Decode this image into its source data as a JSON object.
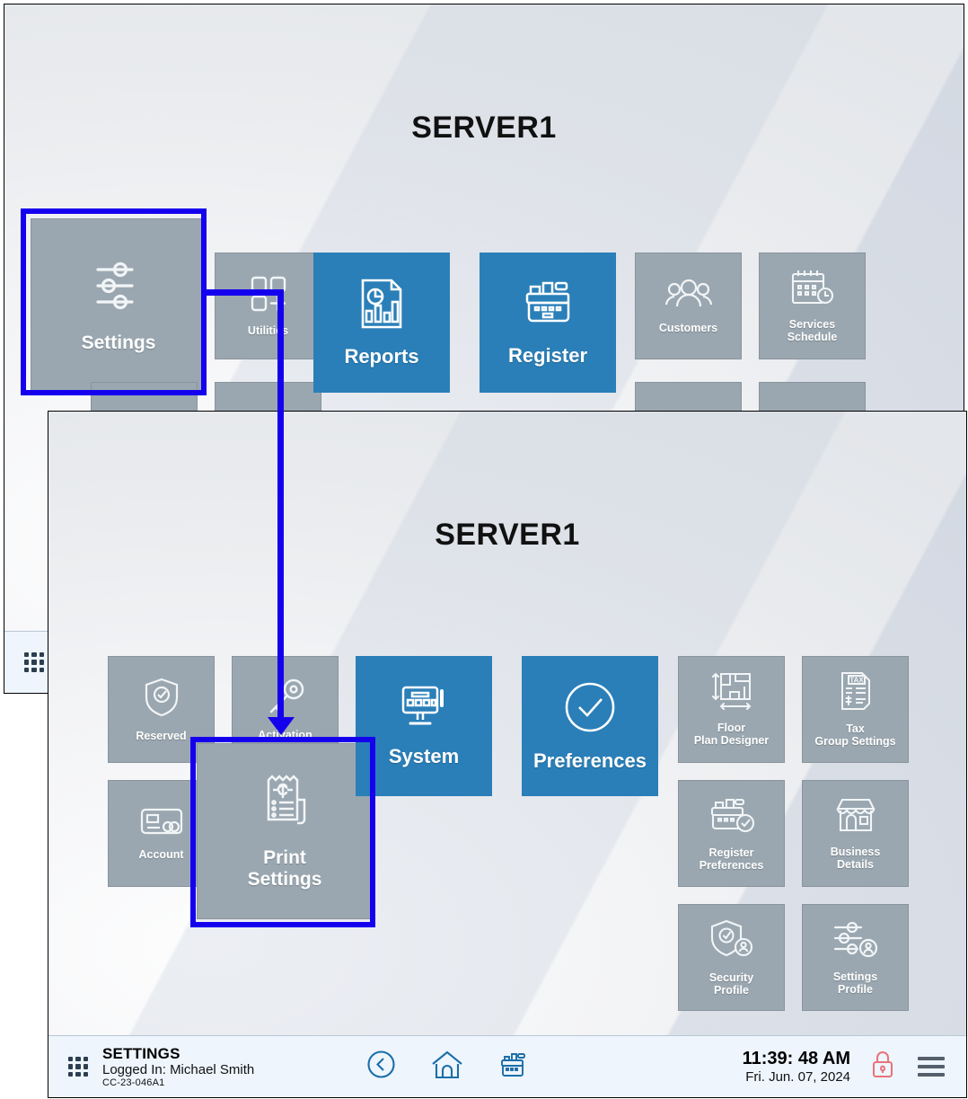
{
  "window1": {
    "title": "SERVER1",
    "tiles": [
      {
        "label": "Settings",
        "icon": "sliders-icon",
        "color": "gray"
      },
      {
        "label": "Utilities",
        "icon": "squares-plus-icon",
        "color": "gray"
      },
      {
        "label": "",
        "icon": "envelope-icon",
        "color": "gray"
      },
      {
        "label": "",
        "icon": "box-icon",
        "color": "gray"
      },
      {
        "label": "Reports",
        "icon": "report-chart-icon",
        "color": "blue"
      },
      {
        "label": "Register",
        "icon": "cash-register-icon",
        "color": "blue"
      },
      {
        "label": "Customers",
        "icon": "people-icon",
        "color": "gray"
      },
      {
        "label": "Services Schedule",
        "icon": "calendar-clock-icon",
        "color": "gray"
      },
      {
        "label": "",
        "icon": "people-icon",
        "color": "gray"
      },
      {
        "label": "",
        "icon": "box-icon",
        "color": "gray"
      }
    ]
  },
  "window2": {
    "title": "SERVER1",
    "tiles_left": [
      {
        "label": "Reserved",
        "icon": "shield-check-icon",
        "color": "gray"
      },
      {
        "label": "Activation",
        "icon": "key-icon",
        "color": "gray"
      },
      {
        "label": "Account",
        "icon": "credit-card-icon",
        "color": "gray"
      },
      {
        "label": "Print Settings",
        "icon": "receipt-icon",
        "color": "gray"
      }
    ],
    "tiles_center": [
      {
        "label": "System",
        "icon": "monitor-pos-icon",
        "color": "blue"
      },
      {
        "label": "Preferences",
        "icon": "check-circle-icon",
        "color": "blue"
      }
    ],
    "tiles_right": [
      {
        "label": "Floor Plan Designer",
        "icon": "floor-plan-icon",
        "color": "gray"
      },
      {
        "label": "Tax Group Settings",
        "icon": "tax-document-icon",
        "color": "gray"
      },
      {
        "label": "Register Preferences",
        "icon": "register-check-icon",
        "color": "gray"
      },
      {
        "label": "Business Details",
        "icon": "storefront-icon",
        "color": "gray"
      },
      {
        "label": "Security Profile",
        "icon": "shield-user-icon",
        "color": "gray"
      },
      {
        "label": "Settings Profile",
        "icon": "sliders-user-icon",
        "color": "gray"
      }
    ],
    "footer": {
      "screen_title": "SETTINGS",
      "logged_in": "Logged In:  Michael Smith",
      "code": "CC-23-046A1",
      "time": "11:39: 48 AM",
      "date": "Fri. Jun. 07, 2024",
      "back_icon": "back-circle-icon",
      "home_icon": "home-icon",
      "register_icon": "cash-register-icon",
      "lock_icon": "lock-icon",
      "menu_icon": "hamburger-menu-icon",
      "grid_icon": "app-grid-icon"
    }
  },
  "annotations": {
    "highlight_source": "Settings",
    "highlight_target": "Print Settings",
    "arrow_color": "#1500ee"
  }
}
